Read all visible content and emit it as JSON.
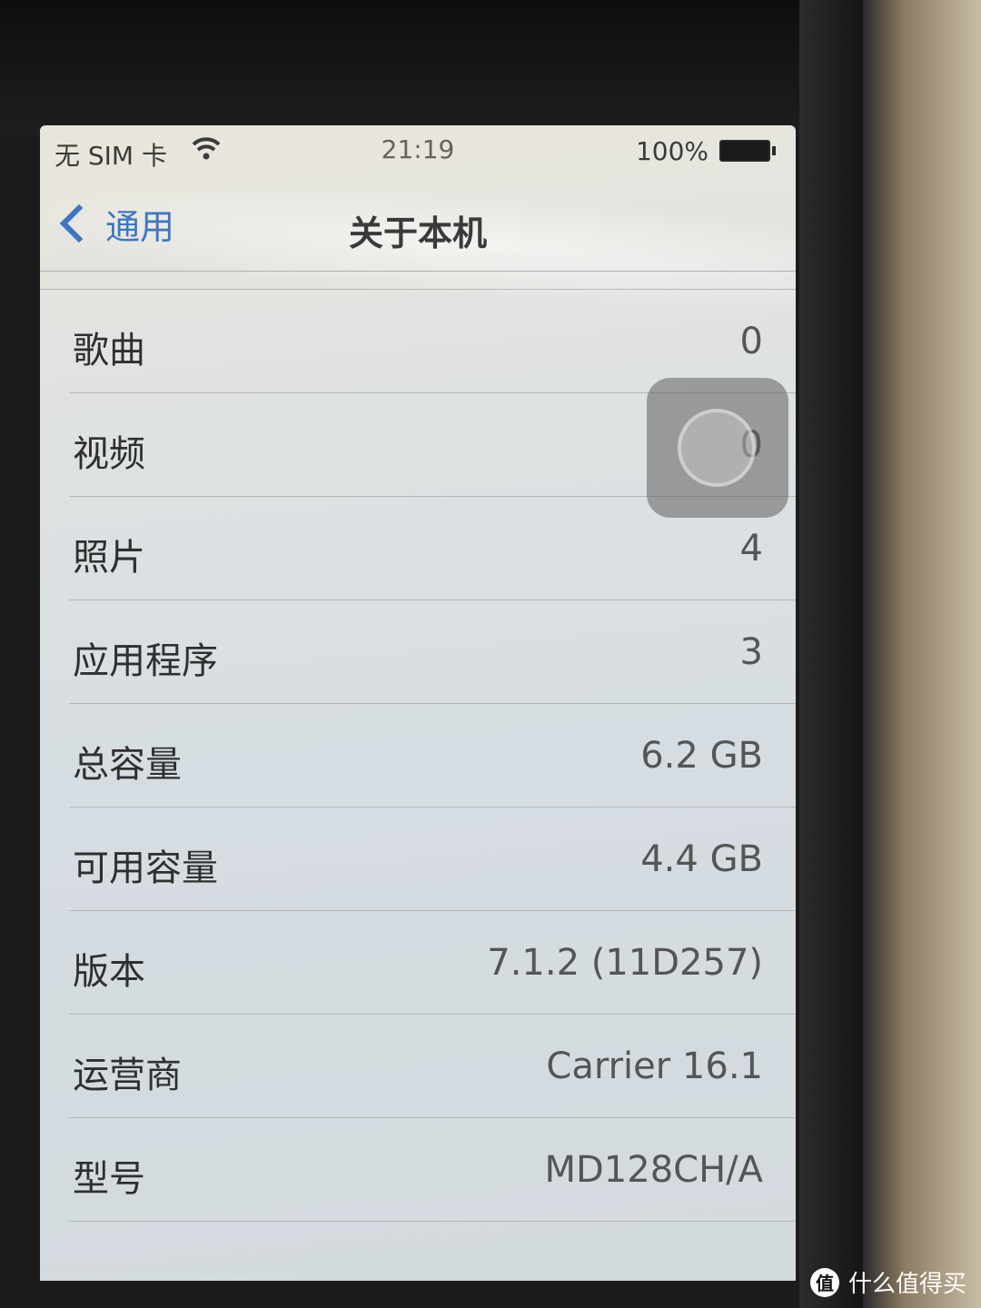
{
  "status_bar": {
    "carrier": "无 SIM 卡",
    "time": "21:19",
    "battery_percent": "100%"
  },
  "nav": {
    "back_label": "通用",
    "title": "关于本机"
  },
  "rows": [
    {
      "label": "歌曲",
      "value": "0"
    },
    {
      "label": "视频",
      "value": "0"
    },
    {
      "label": "照片",
      "value": "4"
    },
    {
      "label": "应用程序",
      "value": "3"
    },
    {
      "label": "总容量",
      "value": "6.2 GB"
    },
    {
      "label": "可用容量",
      "value": "4.4 GB"
    },
    {
      "label": "版本",
      "value": "7.1.2 (11D257)"
    },
    {
      "label": "运营商",
      "value": "Carrier 16.1"
    },
    {
      "label": "型号",
      "value": "MD128CH/A"
    }
  ],
  "watermark": {
    "badge": "值",
    "text": "什么值得买"
  },
  "colors": {
    "accent": "#3f76c0"
  }
}
